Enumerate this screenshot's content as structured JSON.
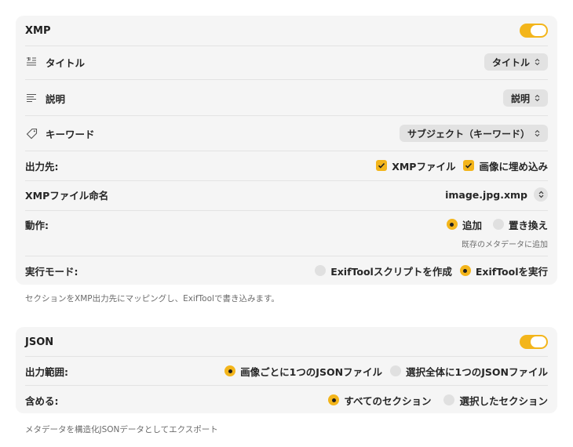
{
  "xmp": {
    "title": "XMP",
    "enabled": true,
    "rows": {
      "title_label": "タイトル",
      "title_popup": "タイトル",
      "description_label": "説明",
      "description_popup": "説明",
      "keywords_label": "キーワード",
      "keywords_popup": "サブジェクト（キーワード）",
      "output_label": "出力先:",
      "output_option_xmp_file": "XMPファイル",
      "output_option_embed": "画像に埋め込み",
      "filename_label": "XMPファイル命名",
      "filename_value": "image.jpg.xmp",
      "action_label": "動作:",
      "action_option_add": "追加",
      "action_option_replace": "置き換え",
      "action_hint": "既存のメタデータに追加",
      "mode_label": "実行モード:",
      "mode_option_script": "ExifToolスクリプトを作成",
      "mode_option_run": "ExifToolを実行"
    },
    "output_xmp_file_checked": true,
    "output_embed_checked": true,
    "action_selected": "追加",
    "mode_selected": "ExifToolを実行",
    "footer_note": "セクションをXMP出力先にマッピングし、ExifToolで書き込みます。"
  },
  "json": {
    "title": "JSON",
    "enabled": true,
    "scope_label": "出力範囲:",
    "scope_option_per_image": "画像ごとに1つのJSONファイル",
    "scope_option_single": "選択全体に1つのJSONファイル",
    "scope_selected": "画像ごとに1つのJSONファイル",
    "include_label": "含める:",
    "include_option_all": "すべてのセクション",
    "include_option_selected": "選択したセクション",
    "include_selected": "すべてのセクション",
    "footer_note": "メタデータを構造化JSONデータとしてエクスポート"
  },
  "colors": {
    "accent": "#f3b51b",
    "panel": "#f5f5f5",
    "control": "#e2e2e2"
  },
  "icons": [
    "title-icon",
    "description-icon",
    "tag-icon",
    "checkmark-icon",
    "chevron-updown-icon"
  ]
}
